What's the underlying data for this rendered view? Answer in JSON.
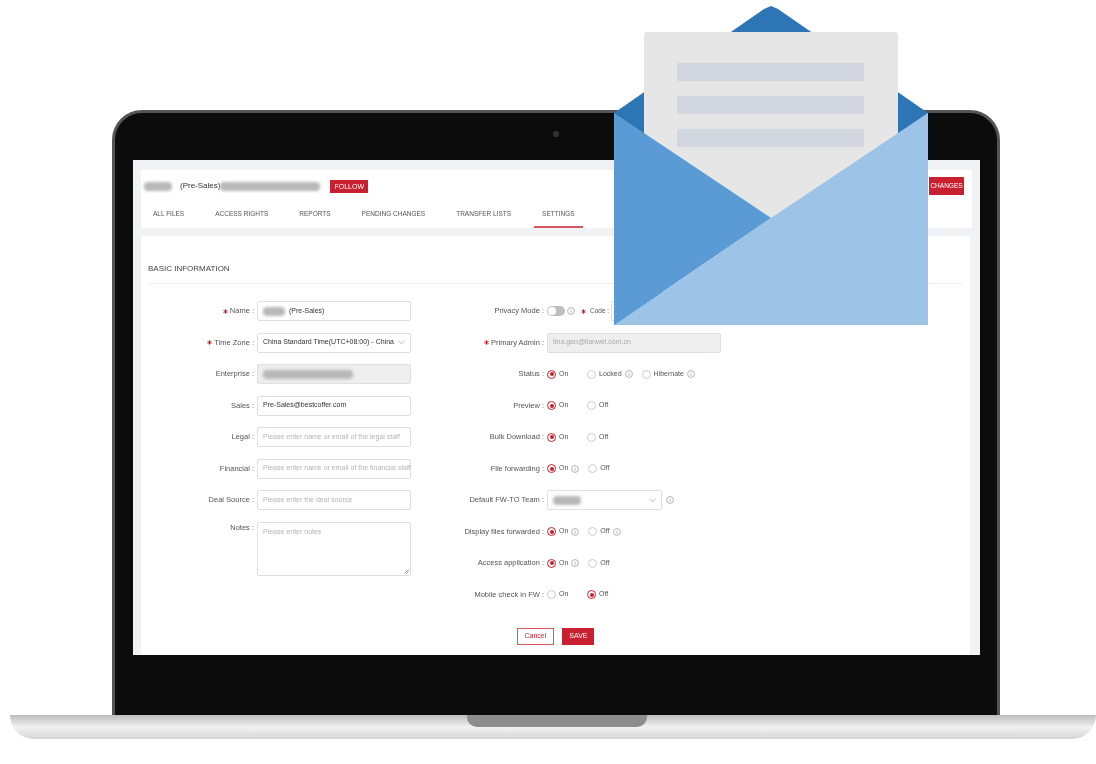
{
  "header": {
    "name_suffix": "(Pre-Sales)",
    "follow_button": "FOLLOW",
    "action_button": "CHANGES"
  },
  "tabs": [
    {
      "label": "ALL FILES",
      "selected": false
    },
    {
      "label": "ACCESS RIGHTS",
      "selected": false
    },
    {
      "label": "REPORTS",
      "selected": false
    },
    {
      "label": "PENDING CHANGES",
      "selected": false
    },
    {
      "label": "TRANSFER LISTS",
      "selected": false
    },
    {
      "label": "SETTINGS",
      "selected": true
    }
  ],
  "section_title": "BASIC INFORMATION",
  "left_fields": [
    {
      "label": "Name :",
      "required": true,
      "kind": "text",
      "redacted": true,
      "value": "(Pre-Sales)"
    },
    {
      "label": "Time Zone :",
      "required": true,
      "kind": "select",
      "value": "China Standard Time(UTC+08:00) - China"
    },
    {
      "label": "Enterprise :",
      "required": false,
      "kind": "disabled",
      "redacted": true
    },
    {
      "label": "Sales :",
      "required": false,
      "kind": "text",
      "value": "Pre-Sales@bestcoffer.com"
    },
    {
      "label": "Legal :",
      "required": false,
      "kind": "text",
      "placeholder": "Please enter name or email of the legal staff"
    },
    {
      "label": "Financial :",
      "required": false,
      "kind": "text",
      "placeholder": "Please enter name or email of the financial staff"
    },
    {
      "label": "Deal Source :",
      "required": false,
      "kind": "text",
      "placeholder": "Please enter the deal source"
    },
    {
      "label": "Notes :",
      "required": false,
      "kind": "textarea",
      "placeholder": "Please enter notes"
    }
  ],
  "right_fields": [
    {
      "label": "Privacy Mode :",
      "required": false,
      "kind": "toggle",
      "on": false,
      "info": true,
      "extra_label": "Code :"
    },
    {
      "label": "Primary Admin :",
      "required": true,
      "kind": "disabled",
      "value": "tina.gan@lianwei.com.cn"
    },
    {
      "label": "Status :",
      "required": false,
      "kind": "radio",
      "options": [
        {
          "label": "On",
          "selected": true,
          "info": false
        },
        {
          "label": "Locked",
          "selected": false,
          "info": true
        },
        {
          "label": "Hibernate",
          "selected": false,
          "info": true
        }
      ]
    },
    {
      "label": "Preview :",
      "required": false,
      "kind": "radio",
      "options": [
        {
          "label": "On",
          "selected": true,
          "info": false
        },
        {
          "label": "Off",
          "selected": false,
          "info": false
        }
      ]
    },
    {
      "label": "Bulk Download :",
      "required": false,
      "kind": "radio",
      "options": [
        {
          "label": "On",
          "selected": true,
          "info": false
        },
        {
          "label": "Off",
          "selected": false,
          "info": false
        }
      ]
    },
    {
      "label": "File forwarding :",
      "required": false,
      "kind": "radio",
      "options": [
        {
          "label": "On",
          "selected": true,
          "info": true
        },
        {
          "label": "Off",
          "selected": false,
          "info": false
        }
      ]
    },
    {
      "label": "Default FW-TO Team :",
      "required": false,
      "kind": "select",
      "redacted": true,
      "info": true
    },
    {
      "label": "Display files forwarded :",
      "required": false,
      "kind": "radio",
      "options": [
        {
          "label": "On",
          "selected": true,
          "info": true
        },
        {
          "label": "Off",
          "selected": false,
          "info": true
        }
      ]
    },
    {
      "label": "Access application :",
      "required": false,
      "kind": "radio",
      "options": [
        {
          "label": "On",
          "selected": true,
          "info": true
        },
        {
          "label": "Off",
          "selected": false,
          "info": false
        }
      ]
    },
    {
      "label": "Mobile check in FW :",
      "required": false,
      "kind": "radio",
      "options": [
        {
          "label": "On",
          "selected": false,
          "info": false
        },
        {
          "label": "Off",
          "selected": true,
          "info": false
        }
      ]
    }
  ],
  "buttons": {
    "cancel": "Cancel",
    "save": "SAVE"
  }
}
